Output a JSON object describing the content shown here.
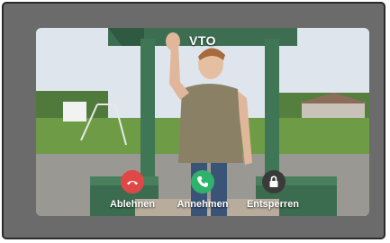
{
  "screen": {
    "title": "VTO"
  },
  "actions": {
    "decline_label": "Ablehnen",
    "accept_label": "Annehmen",
    "unlock_label": "Entsperren"
  },
  "colors": {
    "decline": "#e04848",
    "accept": "#2fb26a",
    "unlock": "#3a3a3a",
    "frame": "#6b6b6b"
  },
  "icons": {
    "decline": "phone-hangup-icon",
    "accept": "phone-icon",
    "unlock": "lock-icon"
  }
}
